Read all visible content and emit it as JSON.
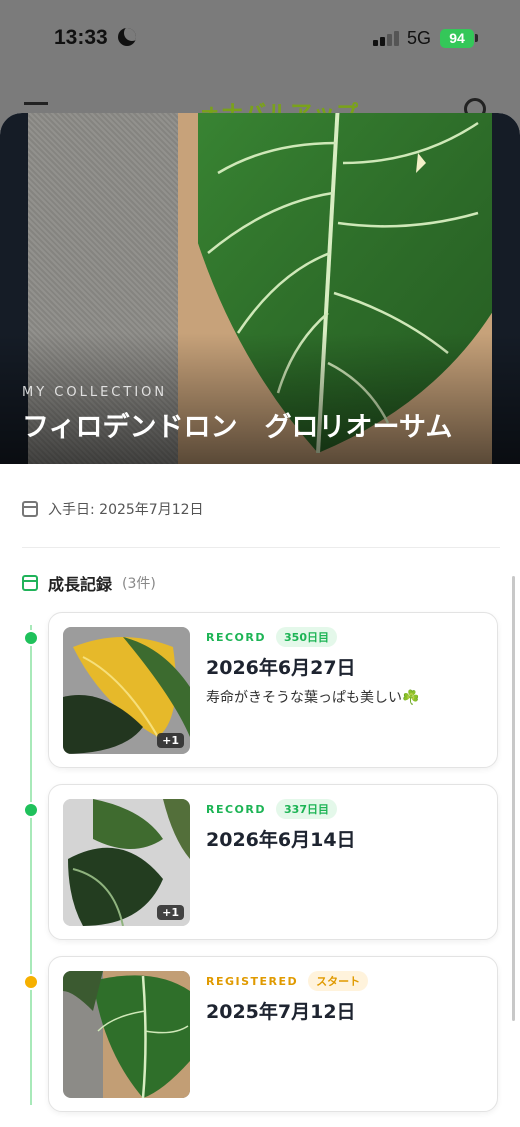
{
  "status_bar": {
    "time": "13:33",
    "network": "5G",
    "battery": "94"
  },
  "app_header": {
    "logo": "ォナバルアップ"
  },
  "hero": {
    "eyebrow": "MY COLLECTION",
    "title": "フィロデンドロン　グロリオーサム"
  },
  "info": {
    "acquired": "入手日: 2025年7月12日"
  },
  "growth": {
    "title": "成長記録",
    "count": "(3件)",
    "records": [
      {
        "label": "RECORD",
        "pill": "350日目",
        "date": "2026年6月27日",
        "note": "寿命がきそうな葉っぱも美しい☘️",
        "photo_count": "+1",
        "status_color": "#1fc15b"
      },
      {
        "label": "RECORD",
        "pill": "337日目",
        "date": "2026年6月14日",
        "note": "",
        "photo_count": "+1",
        "status_color": "#1fc15b"
      },
      {
        "label": "REGISTERED",
        "pill": "スタート",
        "date": "2025年7月12日",
        "note": "",
        "photo_count": "",
        "status_color": "#f6b000"
      }
    ]
  },
  "colors": {
    "accent_green": "#1db455",
    "accent_orange": "#e09a00"
  }
}
